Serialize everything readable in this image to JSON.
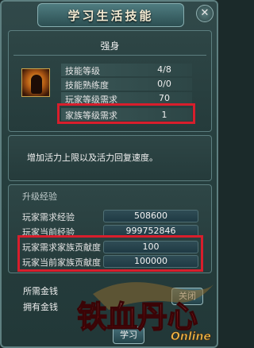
{
  "window": {
    "title": "学习生活技能",
    "close_label": "✕"
  },
  "skill": {
    "name": "强身",
    "icon": "warrior-skill-icon",
    "rows": [
      {
        "label": "技能等级",
        "value": "4/8"
      },
      {
        "label": "技能熟练度",
        "value": "0/0"
      },
      {
        "label": "玩家等级需求",
        "value": "70"
      },
      {
        "label": "家族等级需求",
        "value": "1"
      }
    ]
  },
  "description": "增加活力上限以及活力回复速度。",
  "upgrade": {
    "section_title": "升级经验",
    "rows": [
      {
        "label": "玩家需求经验",
        "value": "508600"
      },
      {
        "label": "玩家当前经验",
        "value": "999752846"
      },
      {
        "label": "玩家需求家族贡献度",
        "value": "100"
      },
      {
        "label": "玩家当前家族贡献度",
        "value": "100000"
      }
    ]
  },
  "money": {
    "required_label": "所需金钱",
    "owned_label": "拥有金钱"
  },
  "buttons": {
    "learn": "学习",
    "close": "关闭"
  },
  "logo": {
    "text": "铁血丹心",
    "sub": "Online"
  },
  "colors": {
    "highlight": "#d81e2c",
    "panel_border": "#5c7e7f"
  }
}
